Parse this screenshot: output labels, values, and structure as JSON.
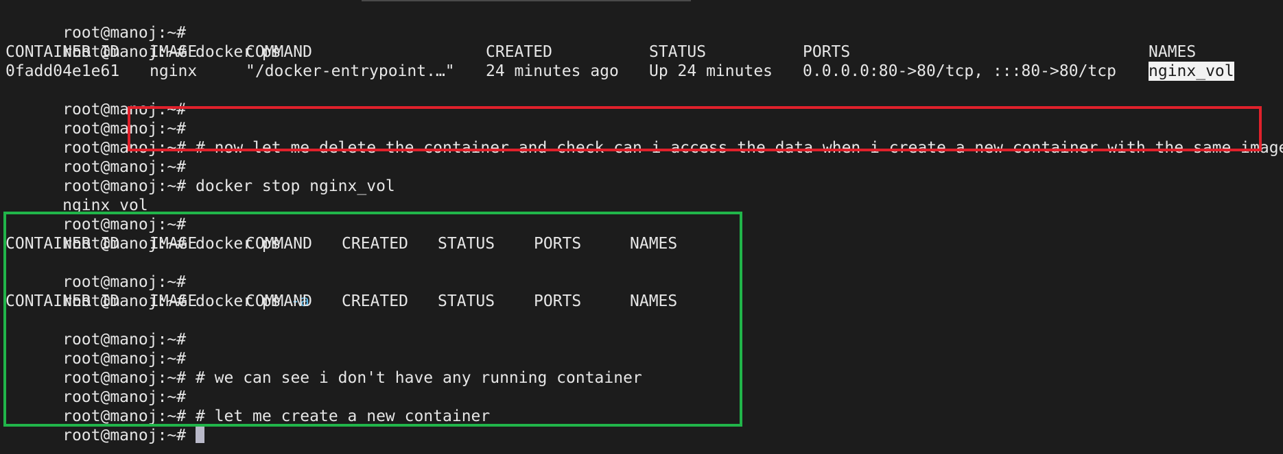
{
  "prompt": "root@manoj:~#",
  "commands": {
    "docker_ps": "docker ps",
    "docker_stop": "docker stop nginx_vol",
    "docker": "docker ps",
    "flag_a": "-a"
  },
  "ps_table_1": {
    "headers": [
      "CONTAINER ID",
      "IMAGE",
      "COMMAND",
      "CREATED",
      "STATUS",
      "PORTS",
      "NAMES"
    ],
    "row": [
      "0fadd04e1e61",
      "nginx",
      "\"/docker-entrypoint.…\"",
      "24 minutes ago",
      "Up 24 minutes",
      "0.0.0.0:80->80/tcp, :::80->80/tcp",
      "nginx_vol"
    ]
  },
  "ps_table_2": {
    "headers": [
      "CONTAINER ID",
      "IMAGE",
      "COMMAND",
      "CREATED",
      "STATUS",
      "PORTS",
      "NAMES"
    ]
  },
  "ps_table_3": {
    "headers": [
      "CONTAINER ID",
      "IMAGE",
      "COMMAND",
      "CREATED",
      "STATUS",
      "PORTS",
      "NAMES"
    ]
  },
  "comments": {
    "delete_note": "# now let me delete the container and check can i access the data when i create a new container with the same image",
    "no_running": "# we can see i don't have any running container",
    "create_new": "# let me create a new container"
  },
  "output": {
    "stopped_name": "nginx_vol"
  },
  "colors": {
    "background": "#1c1c1c",
    "text": "#e6e6e6",
    "flag": "#5fb8e8",
    "annotation_red": "#e0212b",
    "annotation_green": "#21b54a"
  }
}
